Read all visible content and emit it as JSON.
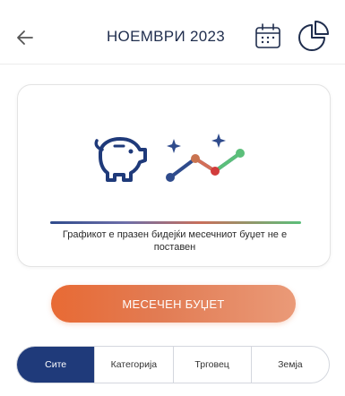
{
  "header": {
    "back_icon": "arrow-left-icon",
    "month_title": "НОЕМВРИ 2023",
    "calendar_icon": "calendar-icon",
    "chart_icon": "pie-chart-icon"
  },
  "empty_state": {
    "piggy_icon": "piggy-bank-icon",
    "graph_icon": "trend-graph-icon",
    "message": "Графикот е празен бидејќи месечниот буџет не е поставен"
  },
  "budget_button": {
    "label": "МЕСЕЧЕН БУЏЕТ",
    "color_start": "#e86a34",
    "color_end": "#ea9a78"
  },
  "filters": {
    "active_color": "#1f3a7a",
    "tabs": [
      {
        "label": "Сите",
        "active": true
      },
      {
        "label": "Категорија",
        "active": false
      },
      {
        "label": "Трговец",
        "active": false
      },
      {
        "label": "Земја",
        "active": false
      }
    ]
  }
}
